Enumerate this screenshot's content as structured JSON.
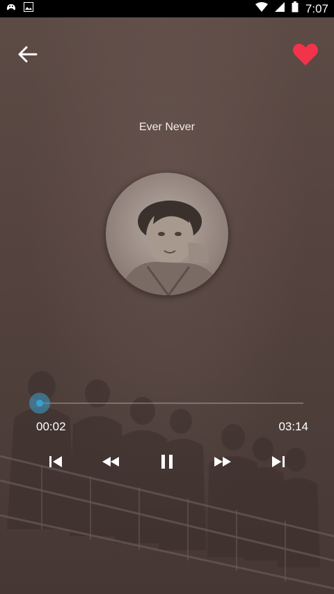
{
  "status_bar": {
    "time": "7:07"
  },
  "player": {
    "song_title": "Ever Never",
    "current_time": "00:02",
    "total_time": "03:14",
    "progress_fraction": 0.01,
    "favorited": true
  },
  "colors": {
    "accent": "#3aa0d0",
    "heart": "#f2334a",
    "background": "#4e3f3b"
  },
  "icons": {
    "back": "back-arrow-icon",
    "favorite": "heart-icon",
    "previous": "skip-previous-icon",
    "rewind": "rewind-icon",
    "pause": "pause-icon",
    "forward": "fast-forward-icon",
    "next": "skip-next-icon"
  }
}
